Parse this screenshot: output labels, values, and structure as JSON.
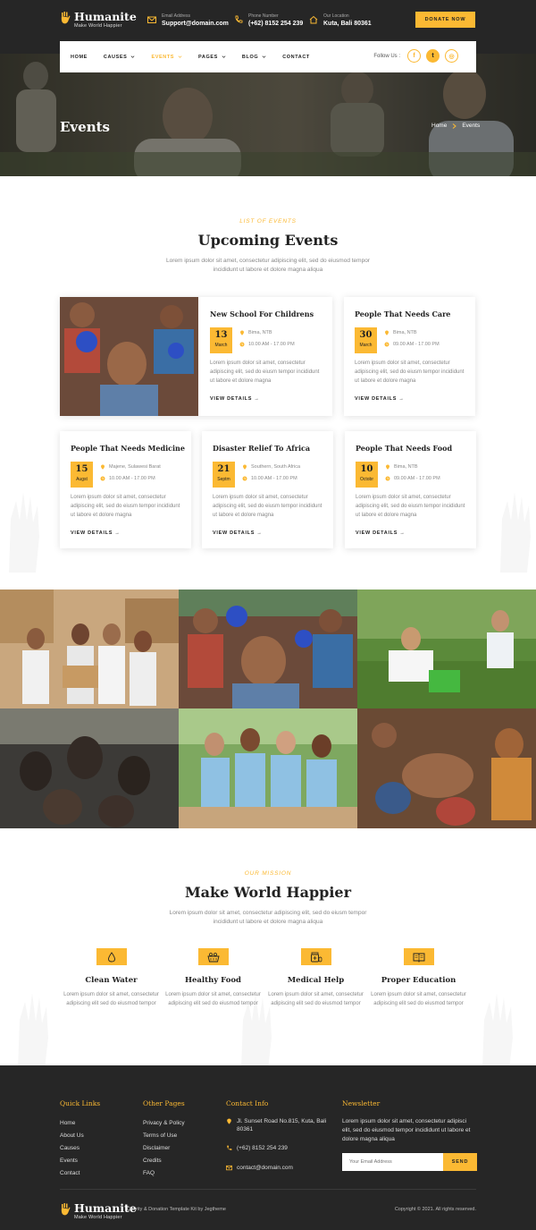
{
  "brand": {
    "name": "Humanite",
    "tagline": "Make World Happier"
  },
  "header": {
    "email": {
      "label": "Email Address",
      "value": "Support@domain.com"
    },
    "phone": {
      "label": "Phone Number",
      "value": "(+62) 8152 254 239"
    },
    "location": {
      "label": "Our Location",
      "value": "Kuta, Bali 80361"
    },
    "donate_label": "DONATE NOW"
  },
  "nav": {
    "items": [
      {
        "label": "HOME",
        "dropdown": false
      },
      {
        "label": "CAUSES",
        "dropdown": true
      },
      {
        "label": "EVENTS",
        "dropdown": true,
        "active": true
      },
      {
        "label": "PAGES",
        "dropdown": true
      },
      {
        "label": "BLOG",
        "dropdown": true
      },
      {
        "label": "CONTACT",
        "dropdown": false
      }
    ],
    "follow_label": "Follow Us :",
    "social": [
      "f",
      "t",
      "◎"
    ]
  },
  "hero": {
    "title": "Events",
    "breadcrumb": {
      "home": "Home",
      "current": "Events"
    }
  },
  "events_section": {
    "kicker": "LIST OF EVENTS",
    "title": "Upcoming Events",
    "subtitle": "Lorem ipsum dolor sit amet, consectetur adipiscing elit, sed do eiusmod tempor incididunt ut labore et dolore magna aliqua"
  },
  "events": [
    {
      "title": "New School For Childrens",
      "day": "13",
      "month": "March",
      "location": "Bima, NTB",
      "time": "10.00 AM - 17.00 PM",
      "desc": "Lorem ipsum dolor sit amet, consectetur adipiscing elit, sed do eiusm tempor incididunt ut labore et dolore magna",
      "cta": "VIEW DETAILS"
    },
    {
      "title": "People That Needs Care",
      "day": "30",
      "month": "March",
      "location": "Bima, NTB",
      "time": "09.00 AM - 17.00 PM",
      "desc": "Lorem ipsum dolor sit amet, consectetur adipiscing elit, sed do eiusm tempor incididunt ut labore et dolore magna",
      "cta": "VIEW DETAILS"
    },
    {
      "title": "People That Needs Medicine",
      "day": "15",
      "month": "Augst",
      "location": "Majene, Sulawesi Barat",
      "time": "10.00 AM - 17.00 PM",
      "desc": "Lorem ipsum dolor sit amet, consectetur adipiscing elit, sed do eiusm tempor incididunt ut labore et dolore magna",
      "cta": "VIEW DETAILS"
    },
    {
      "title": "Disaster Relief To Africa",
      "day": "21",
      "month": "Septm",
      "location": "Southern, South Africa",
      "time": "10.00 AM - 17.00 PM",
      "desc": "Lorem ipsum dolor sit amet, consectetur adipiscing elit, sed do eiusm tempor incididunt ut labore et dolore magna",
      "cta": "VIEW DETAILS"
    },
    {
      "title": "People That Needs Food",
      "day": "10",
      "month": "Octobr",
      "location": "Bima, NTB",
      "time": "09.00 AM - 17.00 PM",
      "desc": "Lorem ipsum dolor sit amet, consectetur adipiscing elit, sed do eiusm tempor incididunt ut labore et dolore magna",
      "cta": "VIEW DETAILS"
    }
  ],
  "mission": {
    "kicker": "OUR MISSION",
    "title": "Make World Happier",
    "subtitle": "Lorem ipsum dolor sit amet, consectetur adipiscing elit, sed do eiusm tempor incididunt ut labore et dolore magna aliqua",
    "features": [
      {
        "title": "Clean Water",
        "icon": "water-drop-icon",
        "desc": "Lorem ipsum dolor sit amet, consectetur adipiscing elit sed do eiusmod tempor"
      },
      {
        "title": "Healthy Food",
        "icon": "food-basket-icon",
        "desc": "Lorem ipsum dolor sit amet, consectetur adipiscing elit sed do eiusmod tempor"
      },
      {
        "title": "Medical Help",
        "icon": "medicine-icon",
        "desc": "Lorem ipsum dolor sit amet, consectetur adipiscing elit sed do eiusmod tempor"
      },
      {
        "title": "Proper Education",
        "icon": "book-icon",
        "desc": "Lorem ipsum dolor sit amet, consectetur adipiscing elit sed do eiusmod tempor"
      }
    ]
  },
  "footer": {
    "quick_links": {
      "title": "Quick Links",
      "items": [
        "Home",
        "About Us",
        "Causes",
        "Events",
        "Contact"
      ]
    },
    "other_pages": {
      "title": "Other Pages",
      "items": [
        "Privacy & Policy",
        "Terms of Use",
        "Disclaimer",
        "Credits",
        "FAQ"
      ]
    },
    "contact": {
      "title": "Contact Info",
      "address": "Jl. Sunset Road No.815, Kuta, Bali 80361",
      "phone": "(+62) 8152 254 239",
      "email": "contact@domain.com"
    },
    "newsletter": {
      "title": "Newsletter",
      "text": "Lorem ipsum dolor sit amet, consectetur adipisci elit, sed do eiusmod tempor incididunt ut labore et dolore magna aliqua",
      "placeholder": "Your Email Address",
      "button": "SEND"
    },
    "credit": "Charity & Donation Template Kit by Jegtheme",
    "copyright": "Copyright © 2021. All rights reserved."
  },
  "colors": {
    "accent": "#fbb933",
    "dark": "#262626"
  }
}
